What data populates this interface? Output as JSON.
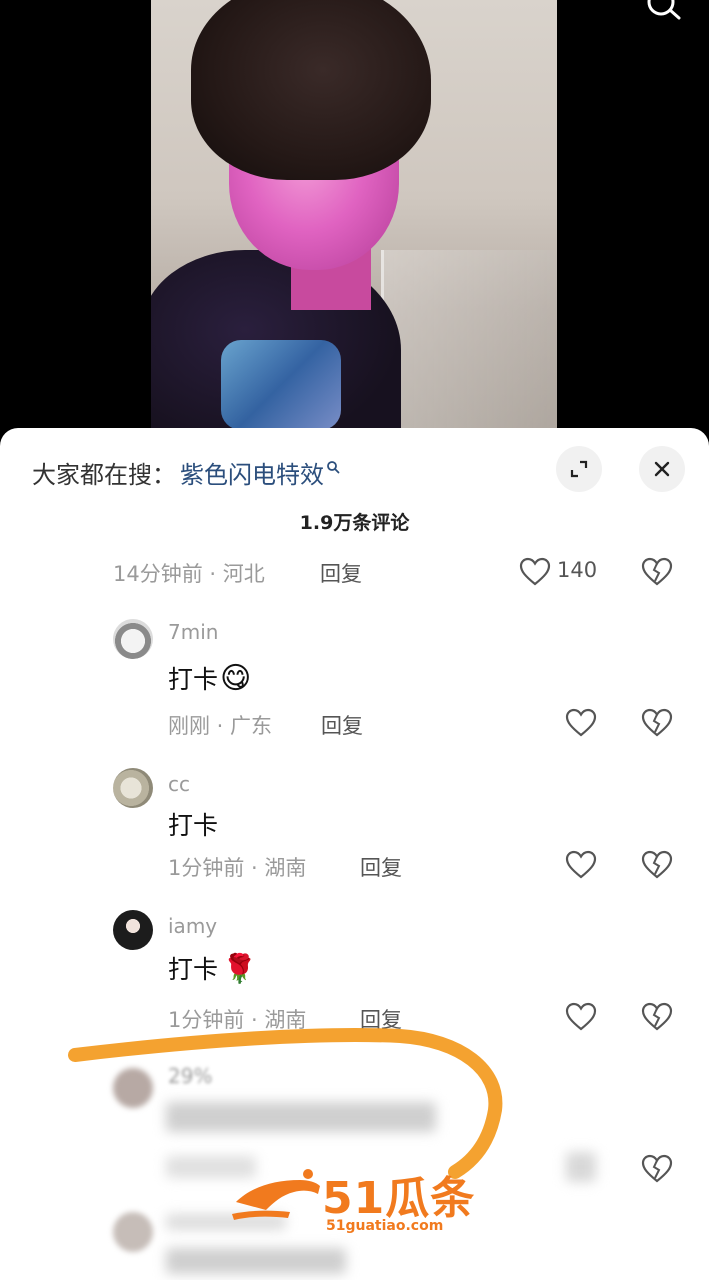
{
  "video": {
    "icon": "search-icon"
  },
  "sheet": {
    "search_prefix": "大家都在搜：",
    "search_term": "紫色闪电特效",
    "comment_count": "1.9万条评论",
    "icons": {
      "expand": "expand-icon",
      "close": "close-icon"
    }
  },
  "comments": {
    "first": {
      "time_location": "14分钟前 · 河北",
      "reply": "回复",
      "likes": "140"
    },
    "c1": {
      "username": "7min",
      "text": "打卡",
      "emoji": "😋",
      "time_location": "刚刚 · 广东",
      "reply": "回复"
    },
    "c2": {
      "username": "cc",
      "text": "打卡",
      "time_location": "1分钟前 · 湖南",
      "reply": "回复"
    },
    "c3": {
      "username": "iamy",
      "text": "打卡",
      "emoji": "🌹",
      "time_location": "1分钟前 · 湖南",
      "reply": "回复"
    },
    "c4": {
      "username": "29%"
    }
  },
  "watermark": {
    "brand": "51瓜条",
    "url": "51guatiao.com"
  },
  "colors": {
    "accent_link": "#2b4e7c",
    "annotation": "#f39a1e",
    "watermark": "#f17a1e"
  }
}
